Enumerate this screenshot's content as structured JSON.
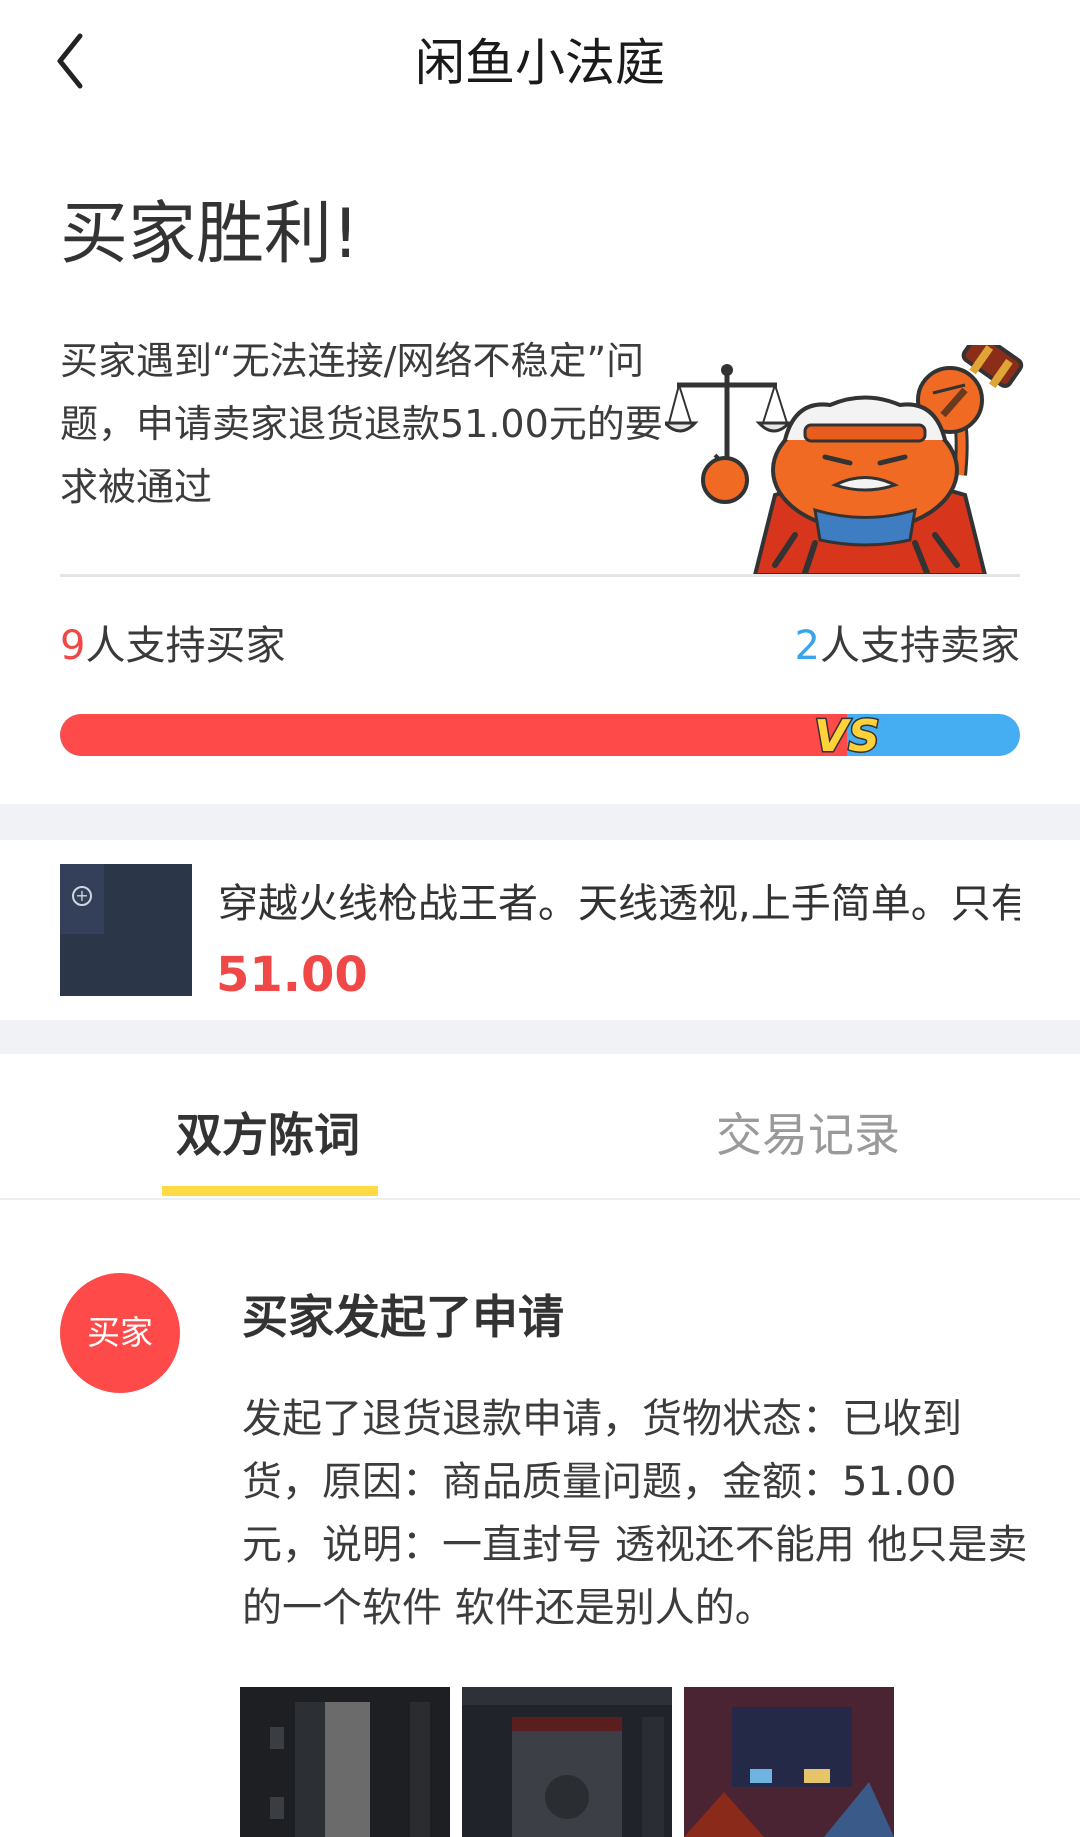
{
  "header": {
    "title": "闲鱼小法庭"
  },
  "verdict": {
    "title": "买家胜利!",
    "description": "买家遇到“无法连接/网络不稳定”问题，申请卖家退货退款51.00元的要求被通过"
  },
  "votes": {
    "buyer_count": "9",
    "buyer_label": "人支持买家",
    "seller_count": "2",
    "seller_label": "人支持卖家",
    "buyer_share": 0.82,
    "vs_label": "VS",
    "buyer_color": "#ff4a4a",
    "seller_color": "#45aef3"
  },
  "product": {
    "title": "穿越火线枪战王者。天线透视,上手简单。只有",
    "price": "51.00"
  },
  "tabs": [
    {
      "label": "双方陈词",
      "active": true
    },
    {
      "label": "交易记录",
      "active": false
    }
  ],
  "entry": {
    "avatar_label": "买家",
    "title": "买家发起了申请",
    "body": "发起了退货退款申请，货物状态：已收到货，原因：商品质量问题，金额：51.00元，说明：一直封号 透视还不能用 他只是卖的一个软件 软件还是别人的。"
  },
  "icons": {
    "back": "chevron-left-icon",
    "mascot": "crab-judge-illustration"
  }
}
